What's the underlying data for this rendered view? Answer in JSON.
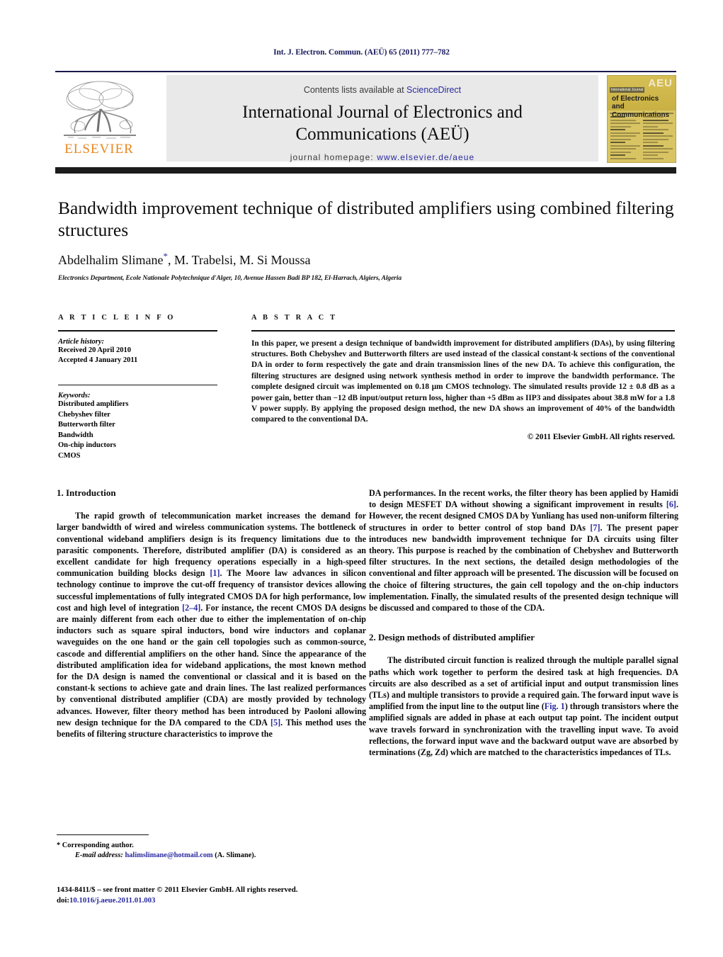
{
  "running_head": "Int. J. Electron. Commun. (AEÜ) 65 (2011) 777–782",
  "masthead": {
    "contents_prefix": "Contents lists available at ",
    "contents_link": "ScienceDirect",
    "journal_title_line1": "International Journal of Electronics and",
    "journal_title_line2": "Communications (AEÜ)",
    "homepage_prefix": "journal homepage: ",
    "homepage_url": "www.elsevier.de/aeue",
    "publisher_logo_text": "ELSEVIER",
    "cover": {
      "badge": "AEU",
      "kicker": "International Journal",
      "line1": "of Electronics and",
      "line2": "Communications",
      "contents_label": "Contents"
    }
  },
  "article": {
    "title": "Bandwidth improvement technique of distributed amplifiers using combined filtering structures",
    "authors": "Abdelhalim Slimane",
    "authors_rest": ", M. Trabelsi, M. Si Moussa",
    "corresponding_mark": "*",
    "affiliation": "Electronics Department, Ecole Nationale Polytechnique d'Alger, 10, Avenue Hassen Badi BP 182, El-Harrach, Algiers, Algeria"
  },
  "article_info": {
    "heading": "A R T I C L E    I N F O",
    "history_label": "Article history:",
    "history": [
      "Received 20 April 2010",
      "Accepted 4 January 2011"
    ],
    "keywords_label": "Keywords:",
    "keywords": [
      "Distributed amplifiers",
      "Chebyshev filter",
      "Butterworth filter",
      "Bandwidth",
      "On-chip inductors",
      "CMOS"
    ]
  },
  "abstract": {
    "heading": "A B S T R A C T",
    "text": "In this paper, we present a design technique of bandwidth improvement for distributed amplifiers (DAs), by using filtering structures. Both Chebyshev and Butterworth filters are used instead of the classical constant-k sections of the conventional DA in order to form respectively the gate and drain transmission lines of the new DA. To achieve this configuration, the filtering structures are designed using network synthesis method in order to improve the bandwidth performance. The complete designed circuit was implemented on 0.18 μm CMOS technology. The simulated results provide 12 ± 0.8 dB as a power gain, better than −12 dB input/output return loss, higher than +5 dBm as IIP3 and dissipates about 38.8 mW for a 1.8 V power supply. By applying the proposed design method, the new DA shows an improvement of 40% of the bandwidth compared to the conventional DA.",
    "copyright": "© 2011 Elsevier GmbH. All rights reserved."
  },
  "body": {
    "section1_heading": "1.  Introduction",
    "section1_p1_a": "The rapid growth of telecommunication market increases the demand for larger bandwidth of wired and wireless communication systems. The bottleneck of conventional wideband amplifiers design is its frequency limitations due to the parasitic components. Therefore, distributed amplifier (DA) is considered as an excellent candidate for high frequency operations especially in a high-speed communication building blocks design ",
    "section1_p1_ref1": "[1]",
    "section1_p1_b": ". The Moore law advances in silicon technology continue to improve the cut-off frequency of transistor devices allowing successful implementations of fully integrated CMOS DA for high performance, low cost and high level of integration ",
    "section1_p1_ref2": "[2–4]",
    "section1_p1_c": ". For instance, the recent CMOS DA designs are mainly different from each other due to either the implementation of on-chip inductors such as square spiral inductors, bond wire inductors and coplanar waveguides on the one hand or the gain cell topologies such as common-source, cascode and differential amplifiers on the other hand. Since the appearance of the distributed amplification idea for wideband applications, the most known method for the DA design is named the conventional or classical and it is based on the constant-k sections to achieve gate and drain lines. The last realized performances by conventional distributed amplifier (CDA) are mostly provided by technology advances. However, filter theory method has been introduced by Paoloni allowing new design technique for the DA compared to the CDA ",
    "section1_p1_ref3": "[5]",
    "section1_p1_d": ". This method uses the benefits of filtering structure characteristics to improve the DA performances. In the recent works, the filter theory has been applied by Hamidi to design MESFET DA without showing a significant improvement in results ",
    "section1_p1_ref4": "[6]",
    "section1_p1_e": ". However, the recent designed CMOS DA by Yunliang has used non-uniform filtering structures in order to better control of stop band DAs ",
    "section1_p1_ref5": "[7]",
    "section1_p1_f": ". The present paper introduces new bandwidth improvement technique for DA circuits using filter theory. This purpose is reached by the combination of Chebyshev and Butterworth filter structures. In the next sections, the detailed design methodologies of the conventional and filter approach will be presented. The discussion will be focused on the choice of filtering structures, the gain cell topology and the on-chip inductors implementation. Finally, the simulated results of the presented design technique will be discussed and compared to those of the CDA.",
    "section2_heading": "2.  Design methods of distributed amplifier",
    "section2_p1_a": "The distributed circuit function is realized through the multiple parallel signal paths which work together to perform the desired task at high frequencies. DA circuits are also described as a set of artificial input and output transmission lines (TLs) and multiple transistors to provide a required gain. The forward input wave is amplified from the input line to the output line (",
    "section2_p1_figref": "Fig. 1",
    "section2_p1_b": ") through transistors where the amplified signals are added in phase at each output tap point. The incident output wave travels forward in synchronization with the travelling input wave. To avoid reflections, the forward input wave and the backward output wave are absorbed by terminations (Zg, Zd) which are matched to the characteristics impedances of TLs."
  },
  "footnote": {
    "corresponding": "* Corresponding author.",
    "email_label": "E-mail address:",
    "email": "halimslimane@hotmail.com",
    "email_suffix": " (A. Slimane)."
  },
  "imprint": {
    "line1": "1434-8411/$ – see front matter © 2011 Elsevier GmbH. All rights reserved.",
    "doi_label": "doi:",
    "doi": "10.1016/j.aeue.2011.01.003"
  },
  "colors": {
    "link": "#2a2aa0",
    "elsevier_orange": "#e8871e",
    "rule_navy": "#1a1a4e",
    "cover_gold": "#d9c463"
  }
}
